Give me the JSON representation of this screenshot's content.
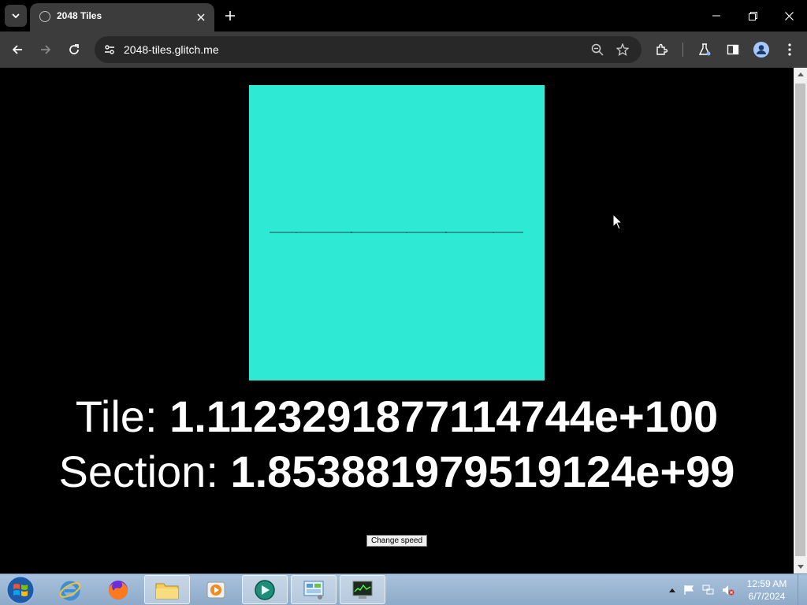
{
  "browser": {
    "tab_title": "2048 Tiles",
    "url": "2048-tiles.glitch.me"
  },
  "page": {
    "tile_label": "Tile: ",
    "tile_value": "1.1123291877114744e+100",
    "section_label": "Section: ",
    "section_value": "1.853881979519124e+99",
    "change_speed_label": "Change speed",
    "canvas_color": "#2eead4"
  },
  "taskbar": {
    "apps": [
      "internet-explorer",
      "firefox",
      "file-explorer",
      "media-player",
      "chrome-app",
      "control-panel",
      "task-manager"
    ],
    "clock_time": "12:59 AM",
    "clock_date": "6/7/2024"
  }
}
